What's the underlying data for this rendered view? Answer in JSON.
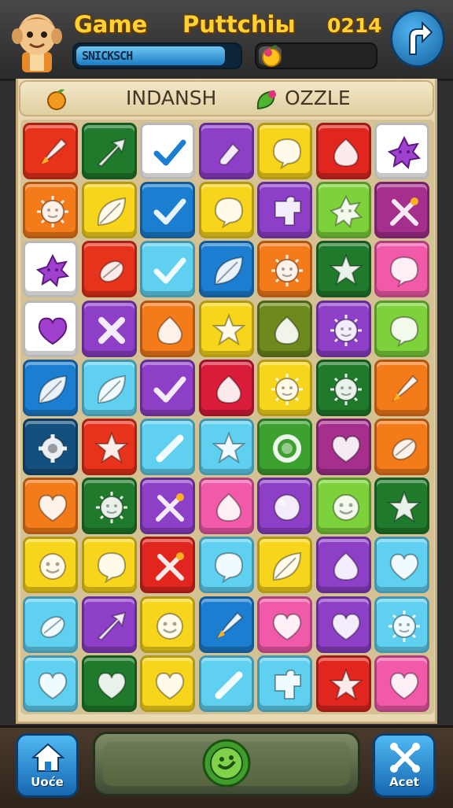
{
  "header": {
    "title_left": "Game",
    "title_mid": "Puttchiы",
    "score": "0214",
    "player_name": "SNICKSCH",
    "progress": 0.2,
    "corner_button_icon": "turn-arrow-icon"
  },
  "banner": {
    "text_left": "INDANSH",
    "text_right": "OZZLE",
    "left_icon": "fruit-icon",
    "mid_icon": "leaf-icon"
  },
  "board": {
    "rows": 10,
    "cols": 7,
    "tiles": [
      [
        {
          "color": "#e8331c",
          "icon": "rocket"
        },
        {
          "color": "#1f7a2b",
          "icon": "arrow"
        },
        {
          "color": "#ffffff",
          "icon": "check"
        },
        {
          "color": "#8d3fc7",
          "icon": "bottle"
        },
        {
          "color": "#f7d51c",
          "icon": "bubble"
        },
        {
          "color": "#e0261f",
          "icon": "drop"
        },
        {
          "color": "#ffffff",
          "icon": "star-face"
        }
      ],
      [
        {
          "color": "#f47b1a",
          "icon": "sun-face"
        },
        {
          "color": "#f7d51c",
          "icon": "leaf"
        },
        {
          "color": "#1c7ed0",
          "icon": "check"
        },
        {
          "color": "#f7d51c",
          "icon": "bubble"
        },
        {
          "color": "#8d3fc7",
          "icon": "puzzle"
        },
        {
          "color": "#7dd13b",
          "icon": "star-face"
        },
        {
          "color": "#a62f8e",
          "icon": "tools"
        }
      ],
      [
        {
          "color": "#ffffff",
          "icon": "star-face"
        },
        {
          "color": "#e8331c",
          "icon": "seed"
        },
        {
          "color": "#5fd0f0",
          "icon": "check"
        },
        {
          "color": "#1c7ed0",
          "icon": "leaf"
        },
        {
          "color": "#f47b1a",
          "icon": "sun-face"
        },
        {
          "color": "#1f7a2b",
          "icon": "star"
        },
        {
          "color": "#f05aa8",
          "icon": "bubble"
        }
      ],
      [
        {
          "color": "#ffffff",
          "icon": "heart"
        },
        {
          "color": "#8d3fc7",
          "icon": "cross"
        },
        {
          "color": "#f47b1a",
          "icon": "drop"
        },
        {
          "color": "#f7d51c",
          "icon": "star"
        },
        {
          "color": "#6f8a1c",
          "icon": "drop"
        },
        {
          "color": "#8d3fc7",
          "icon": "sun-face"
        },
        {
          "color": "#7dd13b",
          "icon": "bubble"
        }
      ],
      [
        {
          "color": "#1c7ed0",
          "icon": "leaf"
        },
        {
          "color": "#5fd0f0",
          "icon": "leaf"
        },
        {
          "color": "#8d3fc7",
          "icon": "check"
        },
        {
          "color": "#d81c3a",
          "icon": "drop"
        },
        {
          "color": "#f7d51c",
          "icon": "sun-face"
        },
        {
          "color": "#1f7a2b",
          "icon": "sun-face"
        },
        {
          "color": "#f47b1a",
          "icon": "rocket"
        }
      ],
      [
        {
          "color": "#14507e",
          "icon": "gear"
        },
        {
          "color": "#e8331c",
          "icon": "star"
        },
        {
          "color": "#5fd0f0",
          "icon": "bone"
        },
        {
          "color": "#5fd0f0",
          "icon": "star"
        },
        {
          "color": "#3da130",
          "icon": "ring"
        },
        {
          "color": "#a62f8e",
          "icon": "heart"
        },
        {
          "color": "#f47b1a",
          "icon": "seed"
        }
      ],
      [
        {
          "color": "#f47b1a",
          "icon": "heart"
        },
        {
          "color": "#1f7a2b",
          "icon": "sun-face"
        },
        {
          "color": "#8d3fc7",
          "icon": "tools"
        },
        {
          "color": "#f05aa8",
          "icon": "drop"
        },
        {
          "color": "#8d3fc7",
          "icon": "ball"
        },
        {
          "color": "#7dd13b",
          "icon": "smile"
        },
        {
          "color": "#1f7a2b",
          "icon": "star"
        }
      ],
      [
        {
          "color": "#f7d51c",
          "icon": "smile"
        },
        {
          "color": "#f7d51c",
          "icon": "bubble"
        },
        {
          "color": "#e0261f",
          "icon": "tools"
        },
        {
          "color": "#5fd0f0",
          "icon": "bubble"
        },
        {
          "color": "#f7d51c",
          "icon": "leaf"
        },
        {
          "color": "#8d3fc7",
          "icon": "drop"
        },
        {
          "color": "#5fd0f0",
          "icon": "heart"
        }
      ],
      [
        {
          "color": "#5fd0f0",
          "icon": "seed"
        },
        {
          "color": "#8d3fc7",
          "icon": "arrow"
        },
        {
          "color": "#f7d51c",
          "icon": "smile"
        },
        {
          "color": "#1c7ed0",
          "icon": "rocket"
        },
        {
          "color": "#f05aa8",
          "icon": "heart"
        },
        {
          "color": "#8d3fc7",
          "icon": "heart"
        },
        {
          "color": "#5fd0f0",
          "icon": "sun-face"
        }
      ],
      [
        {
          "color": "#5fd0f0",
          "icon": "heart"
        },
        {
          "color": "#1f7a2b",
          "icon": "heart"
        },
        {
          "color": "#f7d51c",
          "icon": "heart"
        },
        {
          "color": "#5fd0f0",
          "icon": "bone"
        },
        {
          "color": "#5fd0f0",
          "icon": "puzzle"
        },
        {
          "color": "#e0261f",
          "icon": "star"
        },
        {
          "color": "#f05aa8",
          "icon": "heart"
        }
      ]
    ]
  },
  "footer": {
    "home_label": "Uoće",
    "home_icon": "home-icon",
    "action_label": "Acet",
    "action_icon": "cross-tools-icon",
    "center_icon": "coin-icon"
  }
}
